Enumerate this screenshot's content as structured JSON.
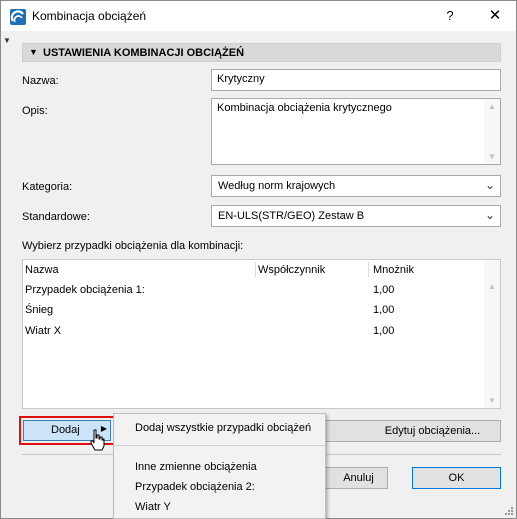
{
  "window": {
    "title": "Kombinacja obciążeń",
    "help_label": "?",
    "close_label": "✕"
  },
  "section": {
    "title": "USTAWIENIA KOMBINACJI OBCIĄŻEŃ"
  },
  "form": {
    "name_label": "Nazwa:",
    "name_value": "Krytyczny",
    "description_label": "Opis:",
    "description_value": "Kombinacja obciążenia krytycznego",
    "category_label": "Kategoria:",
    "category_value": "Według norm krajowych",
    "standard_label": "Standardowe:",
    "standard_value": "EN-ULS(STR/GEO) Zestaw B"
  },
  "load_cases": {
    "prompt": "Wybierz przypadki obciążenia dla kombinacji:",
    "columns": [
      "Nazwa",
      "Współczynnik",
      "Mnożnik"
    ],
    "rows": [
      {
        "name": "Przypadek obciążenia 1:",
        "factor": "",
        "multiplier": "1,00"
      },
      {
        "name": "Śnieg",
        "factor": "",
        "multiplier": "1,00"
      },
      {
        "name": "Wiatr X",
        "factor": "",
        "multiplier": "1,00"
      }
    ]
  },
  "buttons": {
    "add": "Dodaj",
    "edit_loads": "Edytuj obciążenia...",
    "cancel": "Anuluj",
    "ok": "OK"
  },
  "add_menu": {
    "add_all": "Dodaj wszystkie przypadki obciążeń",
    "items": [
      "Inne zmienne obciążenia",
      "Przypadek obciążenia 2:",
      "Wiatr Y"
    ]
  },
  "icons": {
    "app": "archicad-logo-icon",
    "collapse": "triangle-down-icon",
    "submenu": "triangle-right-icon",
    "dropdown": "chevron-down-icon",
    "cursor": "hand-pointer-cursor-icon"
  },
  "colors": {
    "highlight_outline": "#e01010",
    "selected_button": "#cce4f7",
    "default_button_border": "#0078d7"
  }
}
